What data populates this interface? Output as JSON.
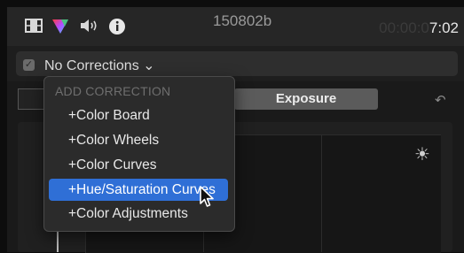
{
  "toolbar": {
    "icons": [
      "film-strip-icon",
      "color-triangle-icon",
      "speaker-icon",
      "info-icon"
    ],
    "clip_name": "150802b",
    "timecode_dim": "00:00:0",
    "timecode_bright": "7:02"
  },
  "correction": {
    "selector_label": "No Corrections ⌄",
    "checked": true
  },
  "tabs": {
    "active_label": "Exposure"
  },
  "menu": {
    "header": "ADD CORRECTION",
    "items": [
      {
        "label": "+Color Board"
      },
      {
        "label": "+Color Wheels"
      },
      {
        "label": "+Color Curves"
      },
      {
        "label": "+Hue/Saturation Curves",
        "highlighted": true
      },
      {
        "label": "+Color Adjustments"
      }
    ]
  },
  "colors": {
    "highlight": "#2f6fd6",
    "background": "#0d0d0d",
    "toolbar": "#262626"
  }
}
